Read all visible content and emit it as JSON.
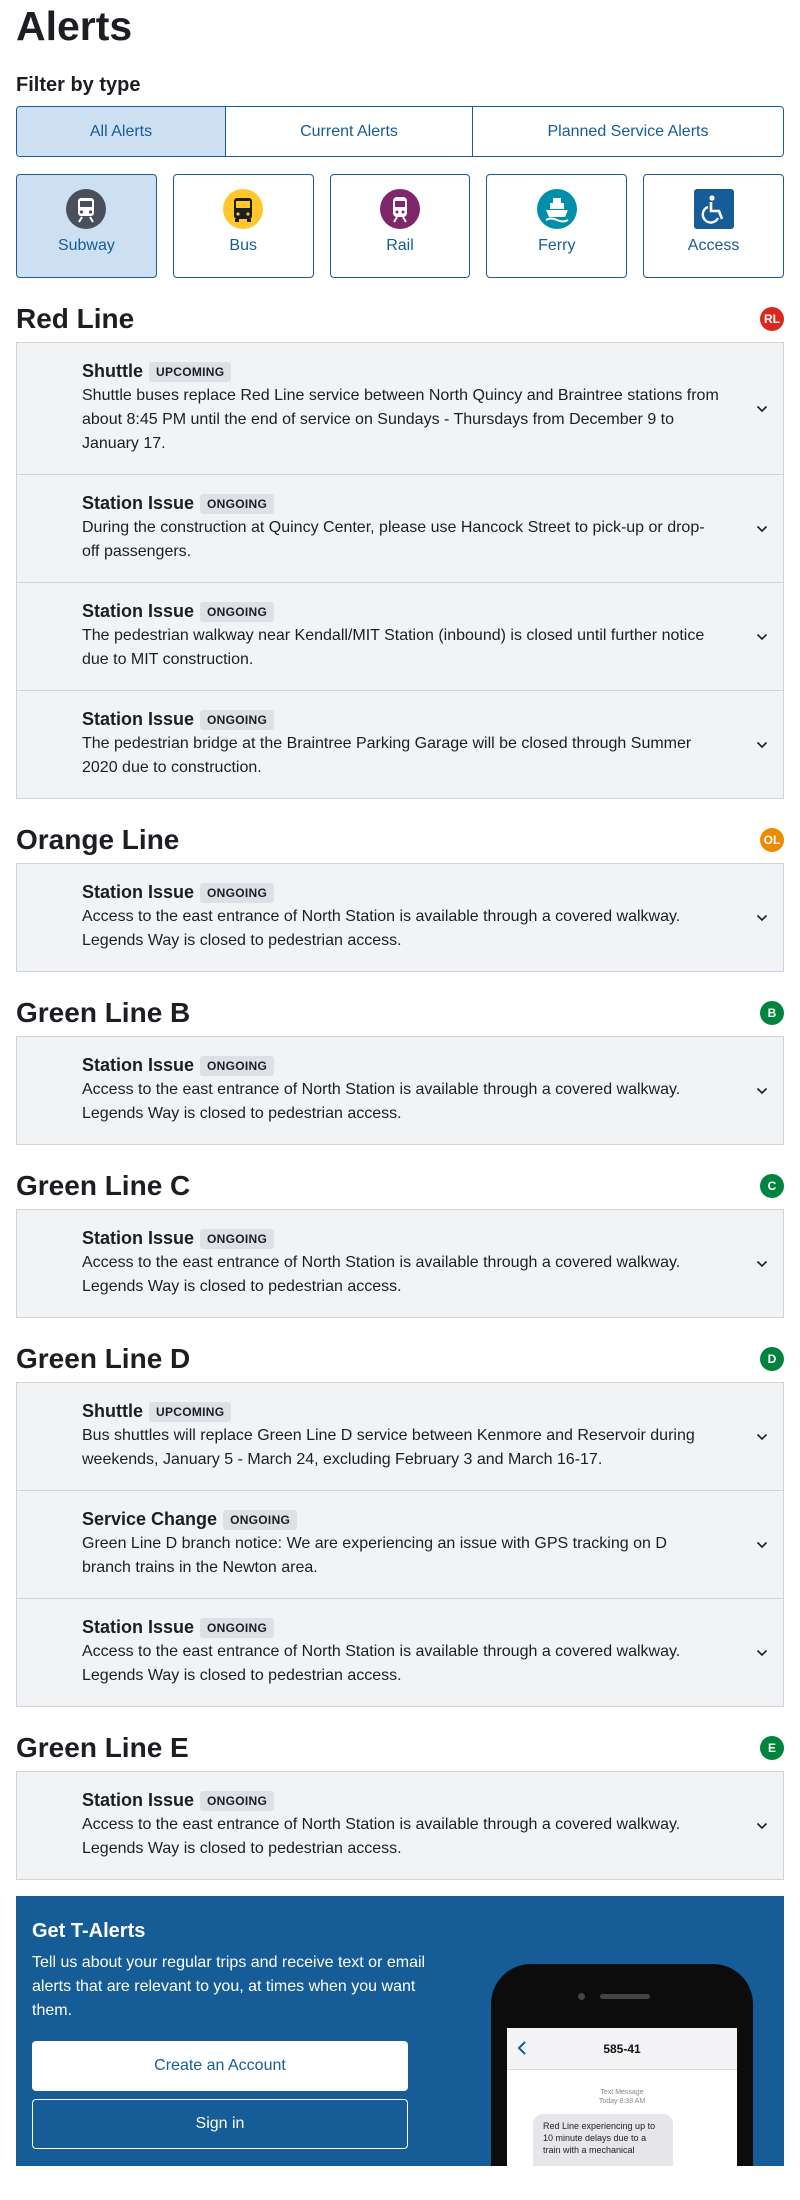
{
  "page_title": "Alerts",
  "filter_label": "Filter by type",
  "tabs": [
    {
      "label": "All Alerts",
      "active": true
    },
    {
      "label": "Current Alerts",
      "active": false
    },
    {
      "label": "Planned Service Alerts",
      "active": false
    }
  ],
  "modes": [
    {
      "label": "Subway",
      "icon": "subway-icon",
      "color": "#494f5c",
      "active": true
    },
    {
      "label": "Bus",
      "icon": "bus-icon",
      "color": "#ffc72c",
      "active": false
    },
    {
      "label": "Rail",
      "icon": "rail-icon",
      "color": "#80276c",
      "active": false
    },
    {
      "label": "Ferry",
      "icon": "ferry-icon",
      "color": "#008eaa",
      "active": false
    },
    {
      "label": "Access",
      "icon": "wheelchair-icon",
      "color": "#165c96",
      "active": false
    }
  ],
  "lines": [
    {
      "name": "Red Line",
      "badge": "RL",
      "color": "#da291c",
      "alerts": [
        {
          "type": "Shuttle",
          "status": "UPCOMING",
          "text": "Shuttle buses replace Red Line service between North Quincy and Braintree stations from about 8:45 PM until the end of service on Sundays - Thursdays from December 9 to January 17."
        },
        {
          "type": "Station Issue",
          "status": "ONGOING",
          "text": "During the construction at Quincy Center, please use Hancock Street to pick-up or drop-off passengers."
        },
        {
          "type": "Station Issue",
          "status": "ONGOING",
          "text": "The pedestrian walkway near Kendall/MIT Station (inbound) is closed until further notice due to MIT construction."
        },
        {
          "type": "Station Issue",
          "status": "ONGOING",
          "text": "The pedestrian bridge at the Braintree Parking Garage will be closed through Summer 2020 due to construction."
        }
      ]
    },
    {
      "name": "Orange Line",
      "badge": "OL",
      "color": "#ed8b00",
      "alerts": [
        {
          "type": "Station Issue",
          "status": "ONGOING",
          "text": "Access to the east entrance of North Station is available through a covered walkway. Legends Way is closed to pedestrian access."
        }
      ]
    },
    {
      "name": "Green Line B",
      "badge": "B",
      "color": "#00843d",
      "alerts": [
        {
          "type": "Station Issue",
          "status": "ONGOING",
          "text": "Access to the east entrance of North Station is available through a covered walkway. Legends Way is closed to pedestrian access."
        }
      ]
    },
    {
      "name": "Green Line C",
      "badge": "C",
      "color": "#00843d",
      "alerts": [
        {
          "type": "Station Issue",
          "status": "ONGOING",
          "text": "Access to the east entrance of North Station is available through a covered walkway. Legends Way is closed to pedestrian access."
        }
      ]
    },
    {
      "name": "Green Line D",
      "badge": "D",
      "color": "#00843d",
      "alerts": [
        {
          "type": "Shuttle",
          "status": "UPCOMING",
          "text": "Bus shuttles will replace Green Line D service between Kenmore and Reservoir during weekends, January 5 - March 24, excluding February 3 and March 16-17."
        },
        {
          "type": "Service Change",
          "status": "ONGOING",
          "text": "Green Line D branch notice: We are experiencing an issue with GPS tracking on D branch trains in the Newton area."
        },
        {
          "type": "Station Issue",
          "status": "ONGOING",
          "text": "Access to the east entrance of North Station is available through a covered walkway. Legends Way is closed to pedestrian access."
        }
      ]
    },
    {
      "name": "Green Line E",
      "badge": "E",
      "color": "#00843d",
      "alerts": [
        {
          "type": "Station Issue",
          "status": "ONGOING",
          "text": "Access to the east entrance of North Station is available through a covered walkway. Legends Way is closed to pedestrian access."
        }
      ]
    }
  ],
  "talerts": {
    "title": "Get T-Alerts",
    "text": "Tell us about your regular trips and receive text or email alerts that are relevant to you, at times when you want them.",
    "create_label": "Create an Account",
    "signin_label": "Sign in",
    "phone": {
      "number": "585-41",
      "meta_line1": "Text Message",
      "meta_line2": "Today 8:38 AM",
      "message": "Red Line experiencing up to 10 minute delays due to a train with a mechanical"
    }
  }
}
